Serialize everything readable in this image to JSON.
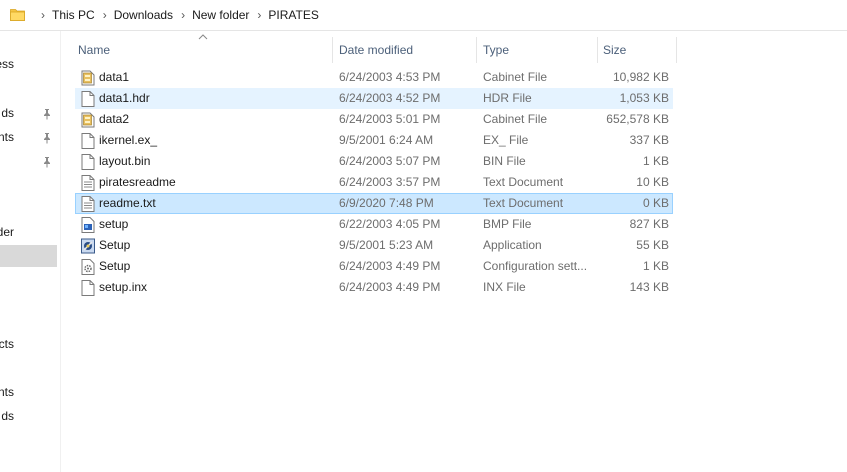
{
  "breadcrumb": [
    "This PC",
    "Downloads",
    "New folder",
    "PIRATES"
  ],
  "nav": {
    "items": [
      {
        "label": "ess",
        "pinned": false
      },
      {
        "label": "ds",
        "pinned": true
      },
      {
        "label": "nts",
        "pinned": true
      },
      {
        "label": "",
        "pinned": true
      },
      {
        "label": "der",
        "pinned": false
      },
      {
        "label": "cts",
        "pinned": false
      },
      {
        "label": "nts",
        "pinned": false
      },
      {
        "label": "ds",
        "pinned": false
      }
    ]
  },
  "columns": {
    "name": "Name",
    "date": "Date modified",
    "type": "Type",
    "size": "Size"
  },
  "files": [
    {
      "name": "data1",
      "date": "6/24/2003 4:53 PM",
      "type": "Cabinet File",
      "size": "10,982 KB",
      "icon": "cabinet-icon",
      "state": "normal"
    },
    {
      "name": "data1.hdr",
      "date": "6/24/2003 4:52 PM",
      "type": "HDR File",
      "size": "1,053 KB",
      "icon": "file-icon",
      "state": "hover"
    },
    {
      "name": "data2",
      "date": "6/24/2003 5:01 PM",
      "type": "Cabinet File",
      "size": "652,578 KB",
      "icon": "cabinet-icon",
      "state": "normal"
    },
    {
      "name": "ikernel.ex_",
      "date": "9/5/2001 6:24 AM",
      "type": "EX_ File",
      "size": "337 KB",
      "icon": "file-icon",
      "state": "normal"
    },
    {
      "name": "layout.bin",
      "date": "6/24/2003 5:07 PM",
      "type": "BIN File",
      "size": "1 KB",
      "icon": "file-icon",
      "state": "normal"
    },
    {
      "name": "piratesreadme",
      "date": "6/24/2003 3:57 PM",
      "type": "Text Document",
      "size": "10 KB",
      "icon": "text-file-icon",
      "state": "normal"
    },
    {
      "name": "readme.txt",
      "date": "6/9/2020 7:48 PM",
      "type": "Text Document",
      "size": "0 KB",
      "icon": "text-file-icon",
      "state": "selected"
    },
    {
      "name": "setup",
      "date": "6/22/2003 4:05 PM",
      "type": "BMP File",
      "size": "827 KB",
      "icon": "bitmap-icon",
      "state": "normal"
    },
    {
      "name": "Setup",
      "date": "9/5/2001 5:23 AM",
      "type": "Application",
      "size": "55 KB",
      "icon": "setup-app-icon",
      "state": "normal"
    },
    {
      "name": "Setup",
      "date": "6/24/2003 4:49 PM",
      "type": "Configuration sett...",
      "size": "1 KB",
      "icon": "config-file-icon",
      "state": "normal"
    },
    {
      "name": "setup.inx",
      "date": "6/24/2003 4:49 PM",
      "type": "INX File",
      "size": "143 KB",
      "icon": "file-icon",
      "state": "normal"
    }
  ]
}
